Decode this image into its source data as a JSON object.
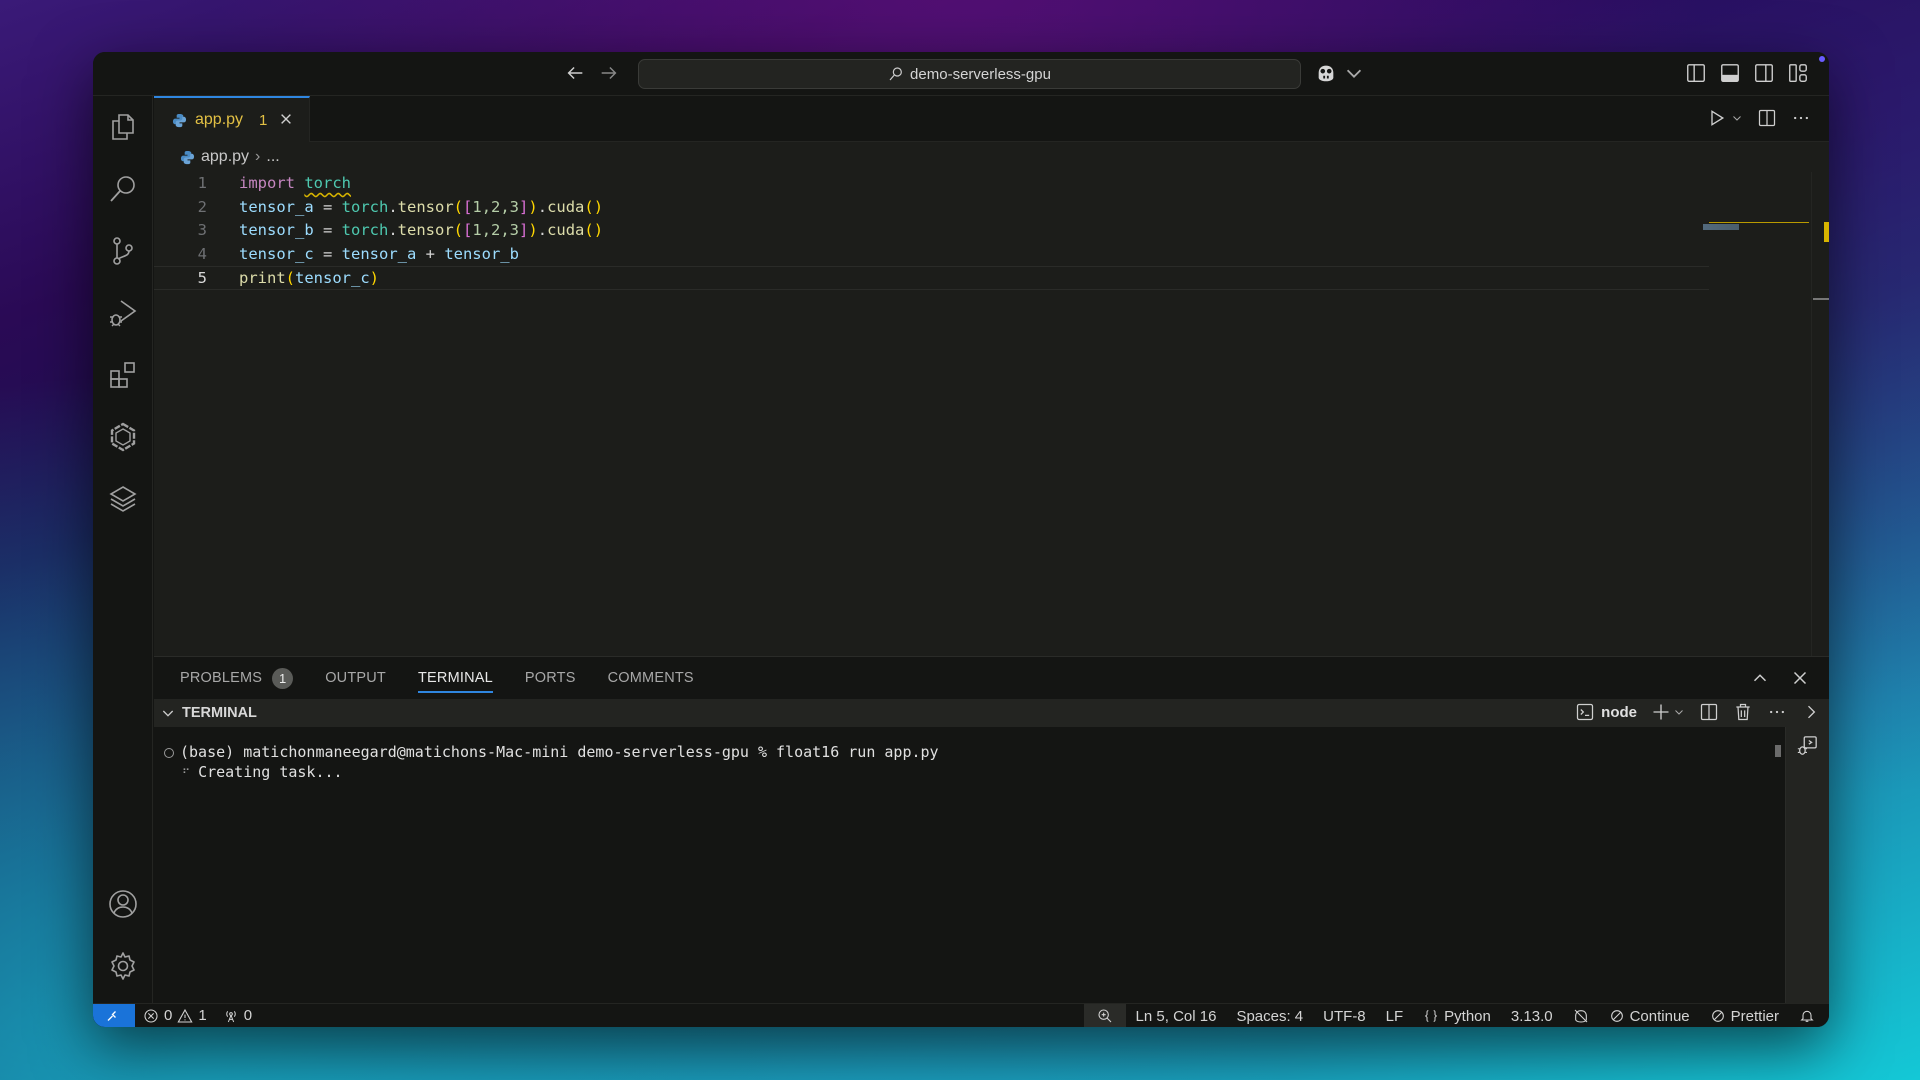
{
  "titlebar": {
    "search_text": "demo-serverless-gpu",
    "icons": [
      "arrow-left-icon",
      "arrow-right-icon",
      "search-icon",
      "copilot-icon",
      "chevron-down-icon",
      "toggle-primary-sidebar-icon",
      "toggle-panel-icon",
      "toggle-secondary-sidebar-icon",
      "customize-layout-icon"
    ]
  },
  "activitybar": {
    "items": [
      {
        "name": "explorer",
        "icon": "files-icon"
      },
      {
        "name": "search",
        "icon": "search-icon"
      },
      {
        "name": "source-control",
        "icon": "source-control-icon"
      },
      {
        "name": "run-and-debug",
        "icon": "run-debug-icon"
      },
      {
        "name": "extensions",
        "icon": "extensions-icon"
      },
      {
        "name": "remote",
        "icon": "hexagon-icon"
      },
      {
        "name": "layers",
        "icon": "layers-icon"
      }
    ],
    "bottom": [
      {
        "name": "accounts",
        "icon": "account-icon"
      },
      {
        "name": "manage",
        "icon": "gear-icon"
      }
    ]
  },
  "editor": {
    "tab": {
      "label": "app.py",
      "badge": "1",
      "close": "✕"
    },
    "breadcrumb": {
      "file": "app.py",
      "sep": "›",
      "rest": "..."
    },
    "line_numbers": [
      "1",
      "2",
      "3",
      "4",
      "5"
    ],
    "active_line": 5,
    "lines": [
      "import torch",
      "tensor_a = torch.tensor([1,2,3]).cuda()",
      "tensor_b = torch.tensor([1,2,3]).cuda()",
      "tensor_c = tensor_a + tensor_b",
      "print(tensor_c)"
    ],
    "tokens": {
      "import": "import",
      "torch": "torch",
      "tensor_a": "tensor_a",
      "tensor_b": "tensor_b",
      "tensor_c": "tensor_c",
      "eq": " = ",
      "dot": ".",
      "tensor_fn": "tensor",
      "cuda": "cuda",
      "lp": "(",
      "rp": ")",
      "lb": "[",
      "rb": "]",
      "nums": "1,2,3",
      "plus": " + ",
      "print": "print",
      "space": " "
    }
  },
  "panel": {
    "tabs": [
      {
        "label": "PROBLEMS",
        "badge": "1"
      },
      {
        "label": "OUTPUT"
      },
      {
        "label": "TERMINAL",
        "active": true
      },
      {
        "label": "PORTS"
      },
      {
        "label": "COMMENTS"
      }
    ],
    "terminal_header": "TERMINAL",
    "terminal_name": "node",
    "lines": [
      "(base) matichonmaneegard@matichons-Mac-mini demo-serverless-gpu % float16 run app.py",
      "Creating task..."
    ],
    "spinner": "⠋"
  },
  "statusbar": {
    "errors": "0",
    "warnings": "1",
    "ports": "0",
    "position": "Ln 5, Col 16",
    "spaces": "Spaces: 4",
    "encoding": "UTF-8",
    "eol": "LF",
    "language": "Python",
    "version": "3.13.0",
    "continue": "Continue",
    "prettier": "Prettier"
  },
  "colors": {
    "accent": "#2f86e0",
    "remote": "#1a73d9",
    "tab_modified": "#e2c044"
  }
}
